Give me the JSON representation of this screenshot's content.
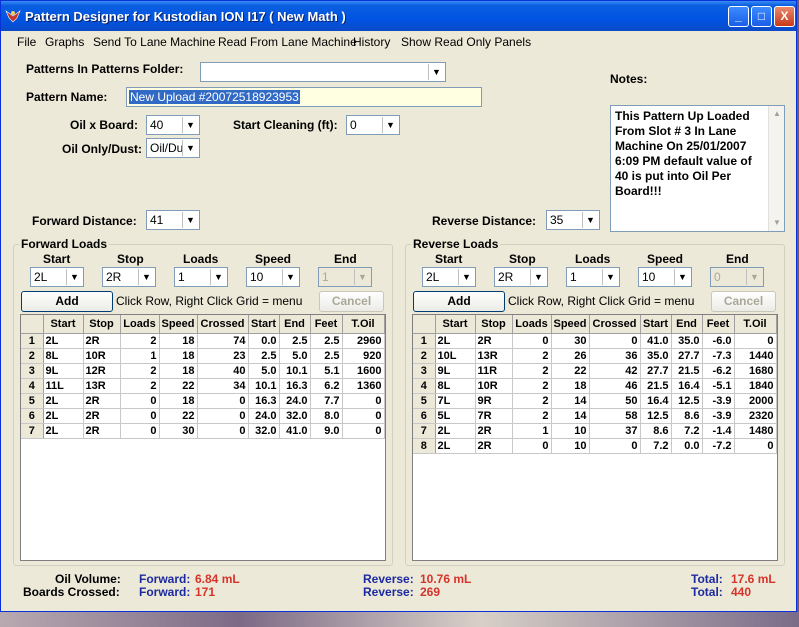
{
  "window": {
    "title": "Pattern Designer for Kustodian ION I17 ( New Math )",
    "buttons": {
      "minimize": "_",
      "maximize": "□",
      "close": "X"
    }
  },
  "menu": [
    "File",
    "Graphs",
    "Send To Lane Machine",
    "Read From Lane Machine",
    "History",
    "Show Read Only Panels"
  ],
  "form": {
    "patterns_folder_label": "Patterns In Patterns Folder:",
    "patterns_folder_value": "",
    "pattern_name_label": "Pattern Name:",
    "pattern_name_value": "New Upload #20072518923953",
    "oil_x_board_label": "Oil x Board:",
    "oil_x_board_value": "40",
    "start_cleaning_label": "Start Cleaning (ft):",
    "start_cleaning_value": "0",
    "oil_only_dust_label": "Oil Only/Dust:",
    "oil_only_dust_value": "Oil/Du",
    "forward_distance_label": "Forward Distance:",
    "forward_distance_value": "41",
    "reverse_distance_label": "Reverse Distance:",
    "reverse_distance_value": "35",
    "notes_label": "Notes:",
    "notes_text": "This Pattern Up Loaded From Slot # 3 In Lane Machine On 25/01/2007 6:09 PM default value of 40 is put into Oil Per Board!!!"
  },
  "forward": {
    "group_label": "Forward Loads",
    "field_labels": [
      "Start",
      "Stop",
      "Loads",
      "Speed",
      "End"
    ],
    "field_values": [
      "2L",
      "2R",
      "1",
      "10",
      "1"
    ],
    "add_label": "Add",
    "hint": "Click Row, Right Click Grid = menu",
    "cancel_label": "Cancel",
    "columns": [
      "",
      "Start",
      "Stop",
      "Loads",
      "Speed",
      "Crossed",
      "Start",
      "End",
      "Feet",
      "T.Oil"
    ],
    "rows": [
      [
        "1",
        "2L",
        "2R",
        "2",
        "18",
        "74",
        "0.0",
        "2.5",
        "2.5",
        "2960"
      ],
      [
        "2",
        "8L",
        "10R",
        "1",
        "18",
        "23",
        "2.5",
        "5.0",
        "2.5",
        "920"
      ],
      [
        "3",
        "9L",
        "12R",
        "2",
        "18",
        "40",
        "5.0",
        "10.1",
        "5.1",
        "1600"
      ],
      [
        "4",
        "11L",
        "13R",
        "2",
        "22",
        "34",
        "10.1",
        "16.3",
        "6.2",
        "1360"
      ],
      [
        "5",
        "2L",
        "2R",
        "0",
        "18",
        "0",
        "16.3",
        "24.0",
        "7.7",
        "0"
      ],
      [
        "6",
        "2L",
        "2R",
        "0",
        "22",
        "0",
        "24.0",
        "32.0",
        "8.0",
        "0"
      ],
      [
        "7",
        "2L",
        "2R",
        "0",
        "30",
        "0",
        "32.0",
        "41.0",
        "9.0",
        "0"
      ]
    ]
  },
  "reverse": {
    "group_label": "Reverse Loads",
    "field_labels": [
      "Start",
      "Stop",
      "Loads",
      "Speed",
      "End"
    ],
    "field_values": [
      "2L",
      "2R",
      "1",
      "10",
      "0"
    ],
    "add_label": "Add",
    "hint": "Click Row, Right Click Grid = menu",
    "cancel_label": "Cancel",
    "columns": [
      "",
      "Start",
      "Stop",
      "Loads",
      "Speed",
      "Crossed",
      "Start",
      "End",
      "Feet",
      "T.Oil"
    ],
    "rows": [
      [
        "1",
        "2L",
        "2R",
        "0",
        "30",
        "0",
        "41.0",
        "35.0",
        "-6.0",
        "0"
      ],
      [
        "2",
        "10L",
        "13R",
        "2",
        "26",
        "36",
        "35.0",
        "27.7",
        "-7.3",
        "1440"
      ],
      [
        "3",
        "9L",
        "11R",
        "2",
        "22",
        "42",
        "27.7",
        "21.5",
        "-6.2",
        "1680"
      ],
      [
        "4",
        "8L",
        "10R",
        "2",
        "18",
        "46",
        "21.5",
        "16.4",
        "-5.1",
        "1840"
      ],
      [
        "5",
        "7L",
        "9R",
        "2",
        "14",
        "50",
        "16.4",
        "12.5",
        "-3.9",
        "2000"
      ],
      [
        "6",
        "5L",
        "7R",
        "2",
        "14",
        "58",
        "12.5",
        "8.6",
        "-3.9",
        "2320"
      ],
      [
        "7",
        "2L",
        "2R",
        "1",
        "10",
        "37",
        "8.6",
        "7.2",
        "-1.4",
        "1480"
      ],
      [
        "8",
        "2L",
        "2R",
        "0",
        "10",
        "0",
        "7.2",
        "0.0",
        "-7.2",
        "0"
      ]
    ]
  },
  "summary": {
    "oil_volume_label": "Oil Volume:",
    "boards_crossed_label": "Boards Crossed:",
    "forward_label": "Forward:",
    "reverse_label": "Reverse:",
    "total_label": "Total:",
    "oil_forward": "6.84 mL",
    "oil_reverse": "10.76 mL",
    "oil_total": "17.6 mL",
    "boards_forward": "171",
    "boards_reverse": "269",
    "boards_total": "440"
  }
}
